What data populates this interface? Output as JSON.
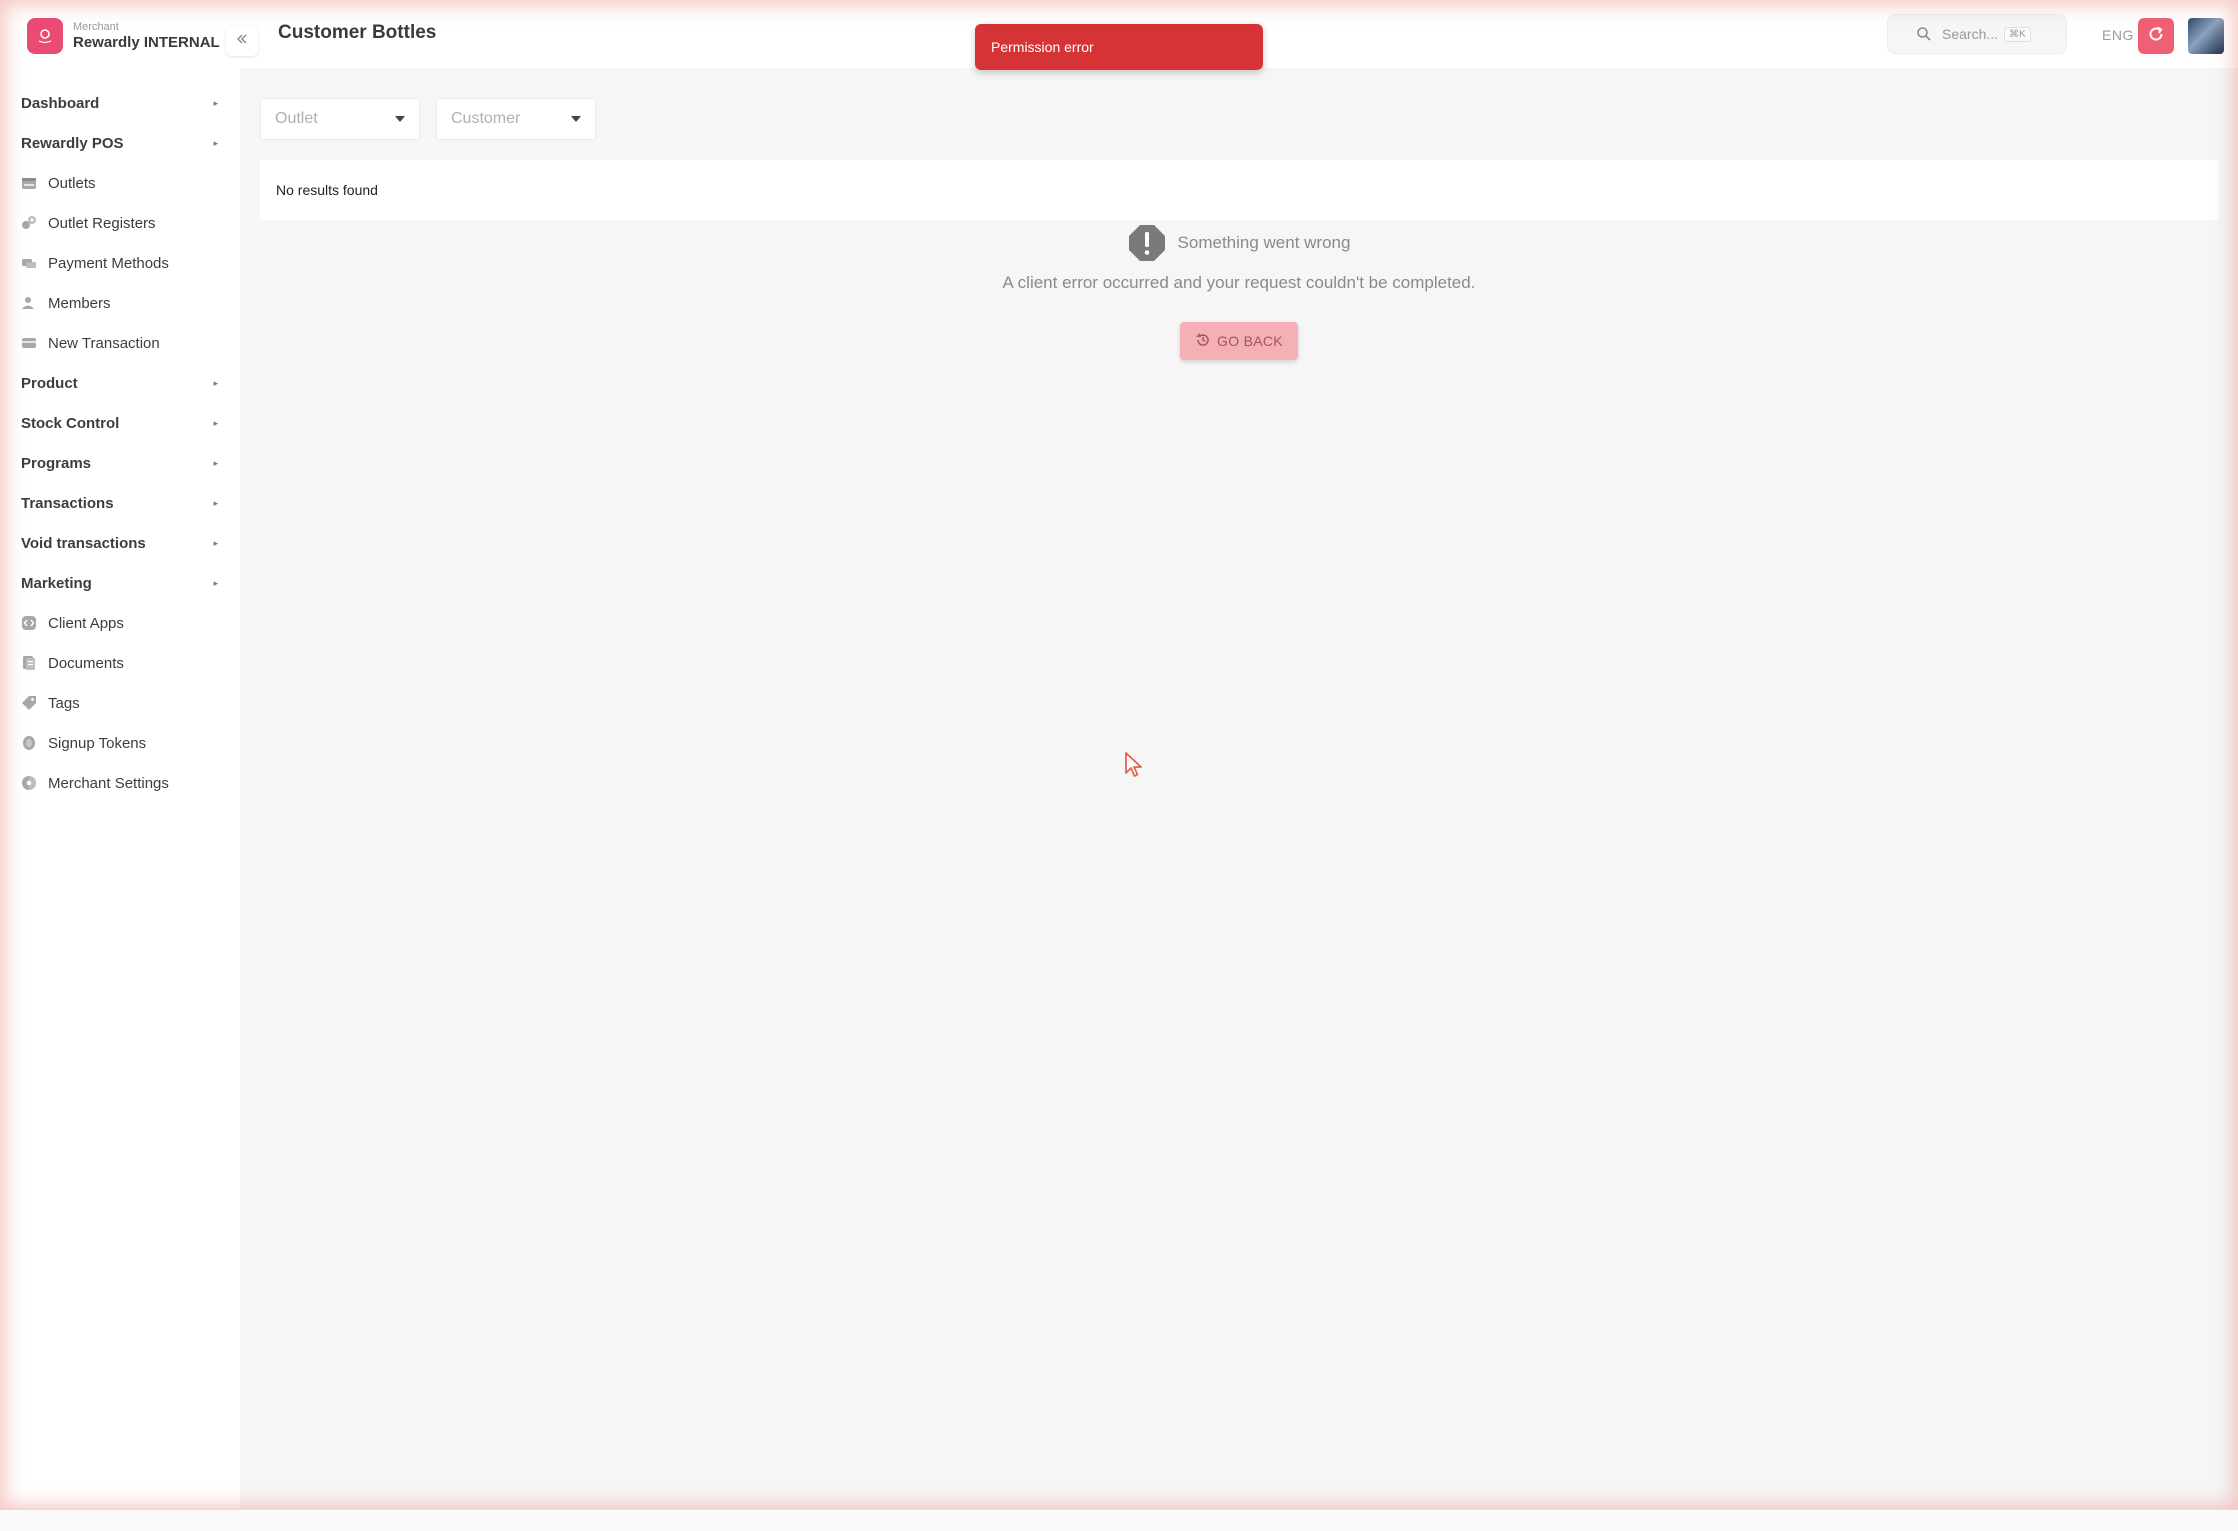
{
  "brand": {
    "subtitle": "Merchant",
    "name": "Rewardly INTERNAL",
    "icon": "rewardly-logo-icon",
    "accent": "#ea4b73"
  },
  "header": {
    "title": "Customer Bottles",
    "search_placeholder": "Search...",
    "search_shortcut": "⌘K",
    "language": "ENG",
    "refresh_icon": "refresh-icon",
    "refresh_color": "#f06074"
  },
  "toast": {
    "message": "Permission error",
    "color": "#d63337"
  },
  "sidebar": {
    "items": [
      {
        "label": "Dashboard",
        "type": "group"
      },
      {
        "label": "Rewardly POS",
        "type": "group"
      },
      {
        "label": "Outlets",
        "type": "link",
        "icon": "store-icon"
      },
      {
        "label": "Outlet Registers",
        "type": "link",
        "icon": "register-icon"
      },
      {
        "label": "Payment Methods",
        "type": "link",
        "icon": "payment-icon"
      },
      {
        "label": "Members",
        "type": "link",
        "icon": "user-icon"
      },
      {
        "label": "New Transaction",
        "type": "link",
        "icon": "card-icon"
      },
      {
        "label": "Product",
        "type": "group"
      },
      {
        "label": "Stock Control",
        "type": "group"
      },
      {
        "label": "Programs",
        "type": "group"
      },
      {
        "label": "Transactions",
        "type": "group"
      },
      {
        "label": "Void transactions",
        "type": "group"
      },
      {
        "label": "Marketing",
        "type": "group"
      },
      {
        "label": "Client Apps",
        "type": "link",
        "icon": "code-icon"
      },
      {
        "label": "Documents",
        "type": "link",
        "icon": "document-icon"
      },
      {
        "label": "Tags",
        "type": "link",
        "icon": "tag-icon"
      },
      {
        "label": "Signup Tokens",
        "type": "link",
        "icon": "token-icon"
      },
      {
        "label": "Merchant Settings",
        "type": "link",
        "icon": "settings-icon"
      }
    ]
  },
  "filters": {
    "outlet_placeholder": "Outlet",
    "customer_placeholder": "Customer"
  },
  "results": {
    "empty_text": "No results found"
  },
  "error": {
    "title": "Something went wrong",
    "message": "A client error occurred and your request couldn't be completed.",
    "button_label": "GO BACK",
    "icon": "warning-octagon-icon"
  }
}
